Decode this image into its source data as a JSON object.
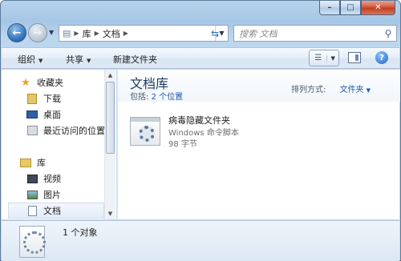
{
  "window": {
    "caption": {
      "minimize": "–",
      "maximize": "□",
      "close": "✕"
    }
  },
  "nav": {
    "address_segments": [
      "库",
      "文档"
    ],
    "search_placeholder": "搜索 文档"
  },
  "toolbar": {
    "organize": "组织",
    "share": "共享",
    "new_folder": "新建文件夹"
  },
  "sidebar": {
    "favorites": "收藏夹",
    "downloads": "下载",
    "desktop": "桌面",
    "recent": "最近访问的位置",
    "libraries": "库",
    "videos": "视频",
    "pictures": "图片",
    "documents": "文档"
  },
  "content": {
    "library_title": "文档库",
    "includes_label": "包括:",
    "includes_link": "2 个位置",
    "arrange_label": "排列方式:",
    "arrange_value": "文件夹",
    "file": {
      "name": "病毒隐藏文件夹",
      "type": "Windows 命令脚本",
      "size": "98 字节"
    }
  },
  "details": {
    "count": "1 个对象"
  }
}
